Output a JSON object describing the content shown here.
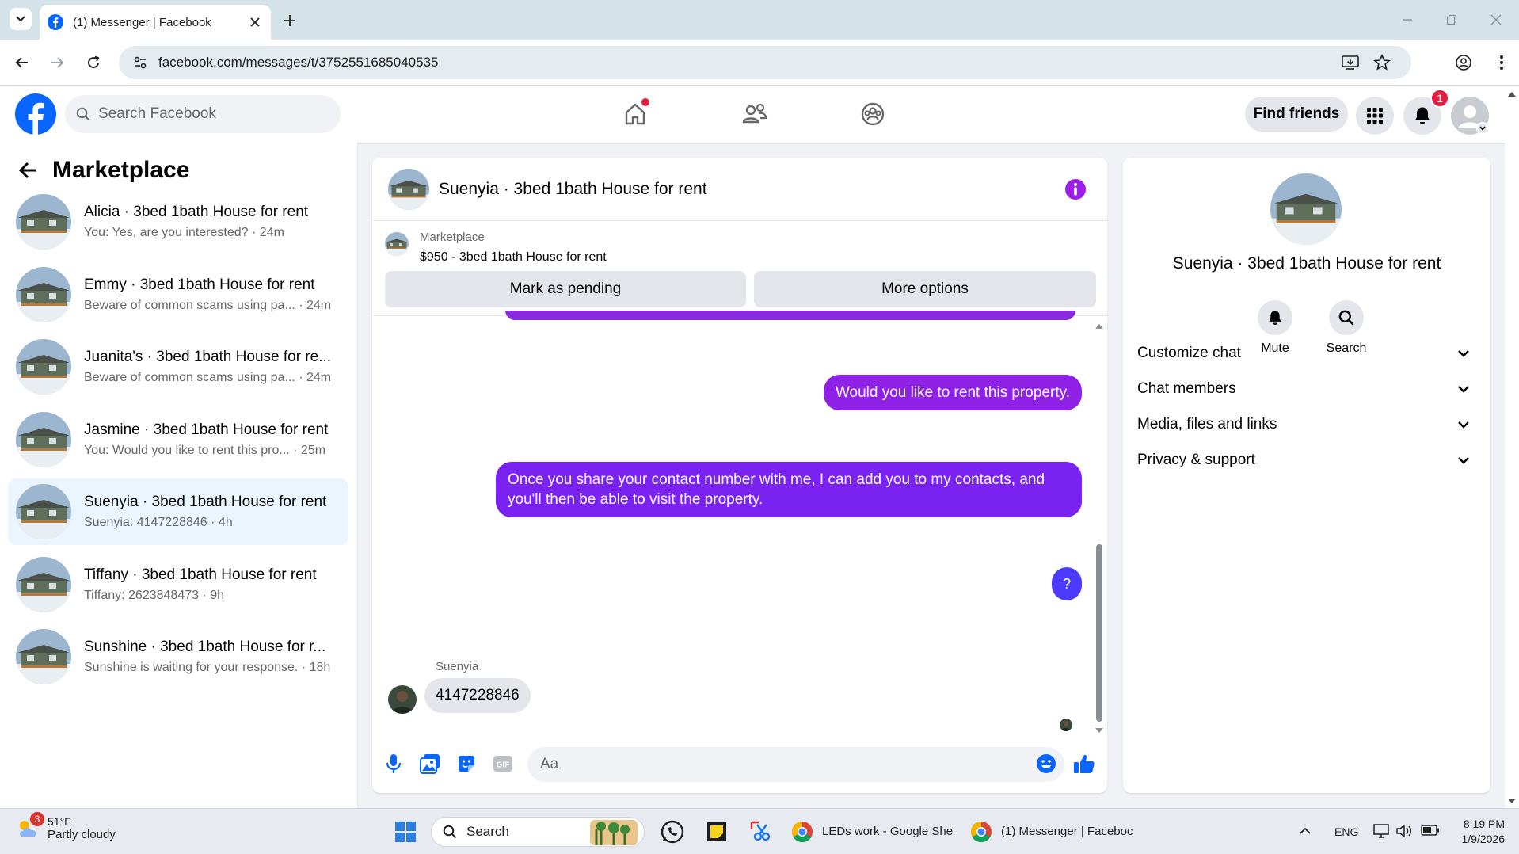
{
  "browser": {
    "tab_title": "(1) Messenger | Facebook",
    "url": "facebook.com/messages/t/3752551685040535"
  },
  "header": {
    "search_placeholder": "Search Facebook",
    "find_friends": "Find friends",
    "notification_count": "1"
  },
  "left": {
    "title": "Marketplace",
    "conversations": [
      {
        "name": "Alicia · 3bed 1bath House for rent",
        "preview": "You: Yes, are you interested? · 24m",
        "active": false
      },
      {
        "name": "Emmy · 3bed 1bath House for rent",
        "preview": "Beware of common scams using pa... · 24m",
        "active": false
      },
      {
        "name": "Juanita's · 3bed 1bath House for re...",
        "preview": "Beware of common scams using pa... · 24m",
        "active": false
      },
      {
        "name": "Jasmine · 3bed 1bath House for rent",
        "preview": "You: Would you like to rent this pro... · 25m",
        "active": false
      },
      {
        "name": "Suenyia · 3bed 1bath House for rent",
        "preview": "Suenyia: 4147228846 · 4h",
        "active": true
      },
      {
        "name": "Tiffany · 3bed 1bath House for rent",
        "preview": "Tiffany: 2623848473 · 9h",
        "active": false
      },
      {
        "name": "Sunshine · 3bed 1bath House for r...",
        "preview": "Sunshine is waiting for your response. · 18h",
        "active": false
      }
    ]
  },
  "chat": {
    "title": "Suenyia · 3bed 1bath House for rent",
    "marketplace_label": "Marketplace",
    "listing": "$950 - 3bed 1bath House for rent",
    "mark_pending": "Mark as pending",
    "more_options": "More options",
    "messages": [
      {
        "from": "me",
        "text": "Would you like to rent this property."
      },
      {
        "from": "me",
        "text": "Once you share your contact number with me, I can add you to my contacts, and you'll then be able to visit the property."
      },
      {
        "from": "me",
        "text": "?"
      },
      {
        "from": "Suenyia",
        "text": "4147228846"
      }
    ],
    "sender_name": "Suenyia",
    "composer_placeholder": "Aa"
  },
  "right": {
    "name": "Suenyia · 3bed 1bath House for rent",
    "mute": "Mute",
    "search": "Search",
    "sections": [
      "Customize chat",
      "Chat members",
      "Media, files and links",
      "Privacy & support"
    ]
  },
  "taskbar": {
    "temp": "51°F",
    "condition": "Partly cloudy",
    "weather_badge": "3",
    "search": "Search",
    "app1": "LEDs work - Google She",
    "app2": "(1) Messenger | Faceboc",
    "lang": "ENG",
    "time": "8:19 PM",
    "date": "1/9/2026"
  },
  "colors": {
    "fb_blue": "#0866ff",
    "bubble_purple": "#8f21e6",
    "bubble_violet": "#7a22f0",
    "bubble_indigo": "#4c3bff",
    "active_row": "#ebf5ff"
  }
}
